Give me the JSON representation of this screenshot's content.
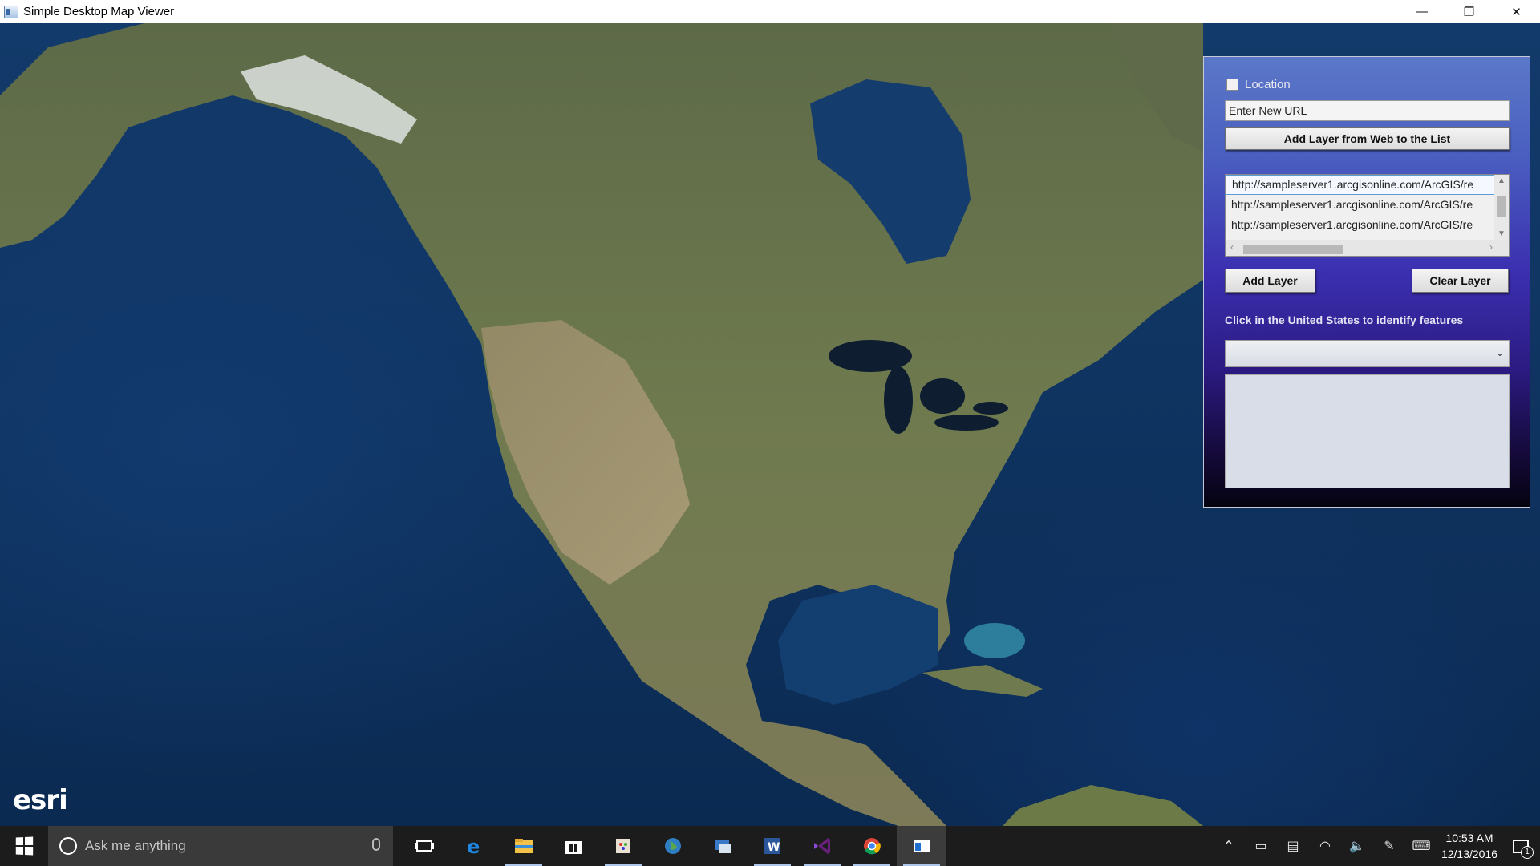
{
  "window": {
    "title": "Simple Desktop Map Viewer",
    "controls": {
      "minimize": "—",
      "restore": "❐",
      "close": "✕"
    }
  },
  "map": {
    "attribution_logo": "esri",
    "colors": {
      "ocean": "#0f3461",
      "land": "#6f7d4c",
      "ice": "#e8ecec"
    }
  },
  "panel": {
    "location_label": "Location",
    "location_checked": false,
    "url_input": {
      "value": "Enter New URL"
    },
    "add_from_web_button": "Add Layer from Web to the List",
    "layer_list": [
      "http://sampleserver1.arcgisonline.com/ArcGIS/re",
      "http://sampleserver1.arcgisonline.com/ArcGIS/re",
      "http://sampleserver1.arcgisonline.com/ArcGIS/re"
    ],
    "add_layer_button": "Add Layer",
    "clear_layer_button": "Clear Layer",
    "identify_hint": "Click in the United States to identify features",
    "identify_select": {
      "value": ""
    },
    "identify_results": ""
  },
  "taskbar": {
    "search_placeholder": "Ask me anything",
    "pinned": [
      {
        "name": "task-view-icon",
        "running": false
      },
      {
        "name": "edge-icon",
        "running": false
      },
      {
        "name": "file-explorer-icon",
        "running": true
      },
      {
        "name": "store-icon",
        "running": false
      },
      {
        "name": "paint-icon",
        "running": true
      },
      {
        "name": "globe-app-icon",
        "running": false
      },
      {
        "name": "remote-desktop-icon",
        "running": false
      },
      {
        "name": "word-icon",
        "running": true
      },
      {
        "name": "visual-studio-icon",
        "running": true
      },
      {
        "name": "chrome-icon",
        "running": true
      },
      {
        "name": "map-viewer-icon",
        "running": true,
        "active": true
      }
    ],
    "clock": {
      "time": "10:53 AM",
      "date": "12/13/2016"
    },
    "notification_count": "1"
  }
}
